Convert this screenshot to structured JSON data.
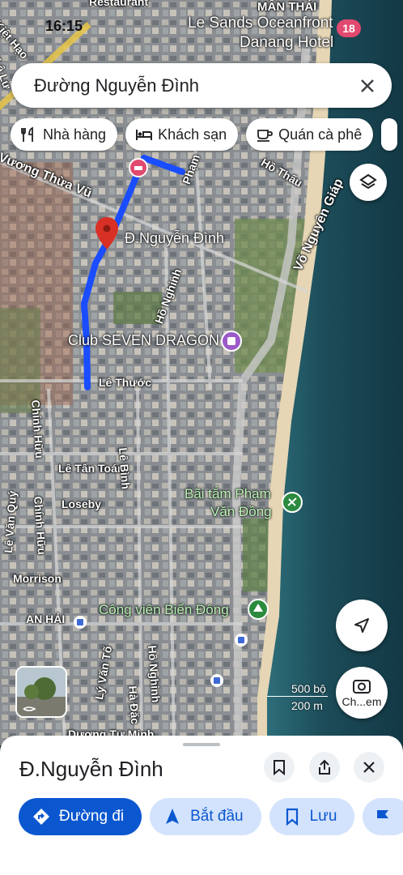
{
  "status_bar": {
    "time": "16:15",
    "notification_count": "18"
  },
  "map": {
    "top_labels": [
      "Restaurant",
      "MÂN THÁI",
      "Le Sands Oceanfront",
      "Danang Hotel"
    ],
    "street_labels": [
      "Kiệt Hạo",
      "Lê Lư",
      "Vương Thừa Vũ",
      "Phạm",
      "Hồ Thấu",
      "Võ Nguyên Giáp",
      "Hồ Nghinh",
      "Lê Thước",
      "Chính Hữu",
      "Lê Tấn Toán",
      "Lê Bình",
      "Loseby",
      "Lê Văn Quý",
      "Chính Hữu",
      "Morrison",
      "AN HẢI",
      "Lý Văn Tố",
      "Hồ Nghinh",
      "Hà Đặc",
      "Dương Tự Minh"
    ],
    "pin_label": "Đ.Nguyễn Đình",
    "poi_club": "Club SEVEN DRAGON",
    "poi_beach_line1": "Bãi tắm Phạm",
    "poi_beach_line2": "Văn Đồng",
    "poi_park": "Công viên Biển Đông",
    "scale_top": "500 bộ",
    "scale_bottom": "200 m",
    "streetview_hint": "Ch...em",
    "route_color": "#1a4dff",
    "pin_color": "#d93025"
  },
  "search": {
    "value": "Đường Nguyễn Đình"
  },
  "chips": [
    {
      "label": "Nhà hàng",
      "icon": "restaurant-icon"
    },
    {
      "label": "Khách sạn",
      "icon": "hotel-icon"
    },
    {
      "label": "Quán cà phê",
      "icon": "coffee-icon"
    }
  ],
  "sheet": {
    "title": "Đ.Nguyễn Đình",
    "actions": [
      {
        "label": "Đường đi",
        "icon": "directions-icon"
      },
      {
        "label": "Bắt đầu",
        "icon": "navigation-icon"
      },
      {
        "label": "Lưu",
        "icon": "bookmark-icon"
      }
    ]
  }
}
